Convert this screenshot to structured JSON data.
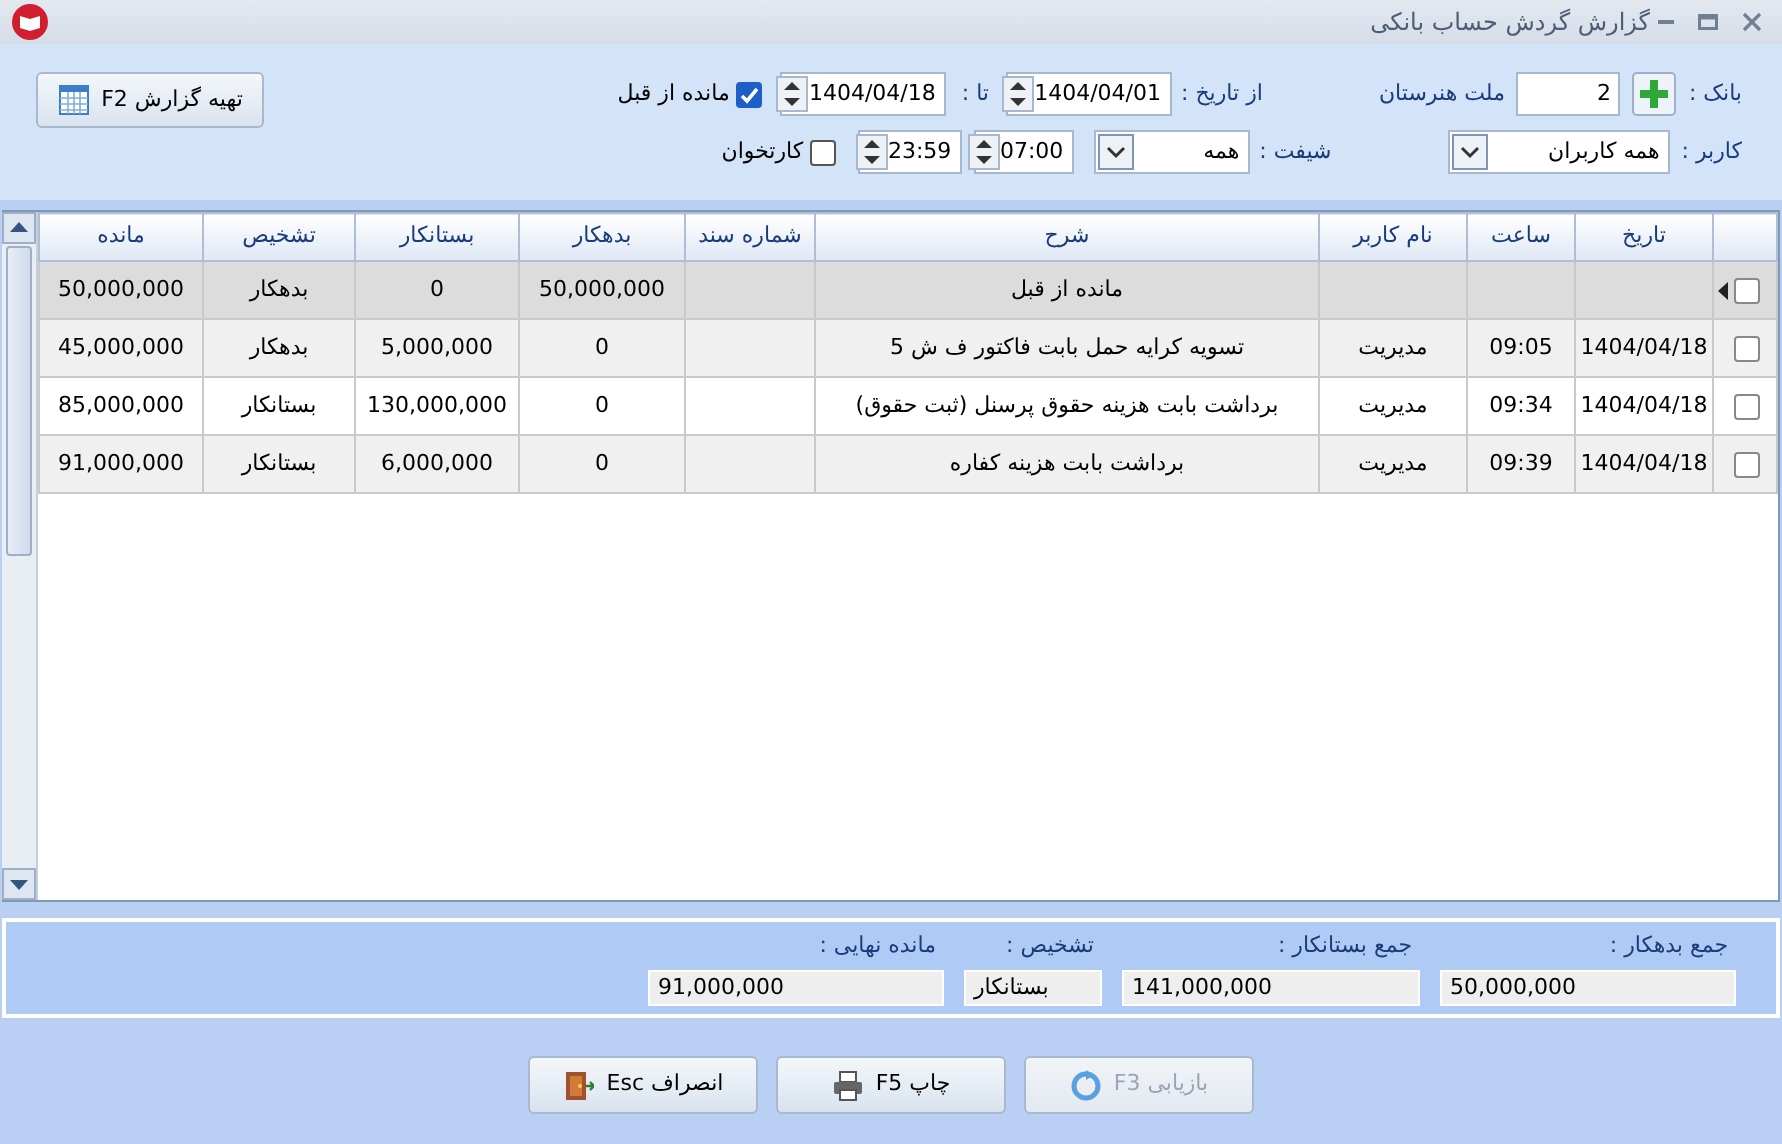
{
  "window": {
    "title": "گزارش گردش حساب بانکی"
  },
  "filters": {
    "bank_label": "بانک :",
    "bank_code": "2",
    "bank_name": "ملت هنرستان",
    "from_label": "از تاریخ :",
    "from_date": "1404/04/01",
    "to_label": "تا :",
    "to_date": "1404/04/18",
    "prior_balance": {
      "label": "مانده از قبل",
      "checked": true
    },
    "user_label": "کاربر :",
    "user": "همه کاربران",
    "shift_label": "شیفت :",
    "shift": "همه",
    "time_from": "07:00",
    "time_to": "23:59",
    "card_reader": {
      "label": "کارتخوان",
      "checked": false
    },
    "report_button": "تهیه گزارش F2"
  },
  "table": {
    "columns": [
      "تاریخ",
      "ساعت",
      "نام کاربر",
      "شرح",
      "شماره سند",
      "بدهکار",
      "بستانکار",
      "تشخیص",
      "مانده"
    ],
    "rows": [
      {
        "current": true,
        "selected": false,
        "cells": [
          null,
          null,
          null,
          "مانده از قبل",
          null,
          "50,000,000",
          "0",
          "بدهکار",
          "50,000,000"
        ]
      },
      {
        "current": false,
        "selected": false,
        "cells": [
          "1404/04/18",
          "09:05",
          "مدیریت",
          "تسویه کرایه حمل بابت فاکتور ف ش 5",
          null,
          "0",
          "5,000,000",
          "بدهکار",
          "45,000,000"
        ]
      },
      {
        "current": false,
        "selected": false,
        "cells": [
          "1404/04/18",
          "09:34",
          "مدیریت",
          "برداشت بابت هزینه حقوق پرسنل (ثبت حقوق)",
          null,
          "0",
          "130,000,000",
          "بستانکار",
          "85,000,000"
        ]
      },
      {
        "current": false,
        "selected": false,
        "cells": [
          "1404/04/18",
          "09:39",
          "مدیریت",
          "برداشت بابت هزینه کفاره",
          null,
          "0",
          "6,000,000",
          "بستانکار",
          "91,000,000"
        ]
      }
    ]
  },
  "summary": [
    {
      "label": "جمع بدهکار :",
      "value": "50,000,000"
    },
    {
      "label": "جمع بستانکار :",
      "value": "141,000,000"
    },
    {
      "label": "تشخیص :",
      "value": "بستانکار"
    },
    {
      "label": "مانده نهایی :",
      "value": "91,000,000"
    }
  ],
  "buttons": [
    {
      "kind": "refresh",
      "label": "بازیابی F3",
      "disabled": true
    },
    {
      "kind": "print",
      "label": "چاپ F5",
      "disabled": false
    },
    {
      "kind": "exit",
      "label": "انصراف Esc",
      "disabled": false
    }
  ]
}
